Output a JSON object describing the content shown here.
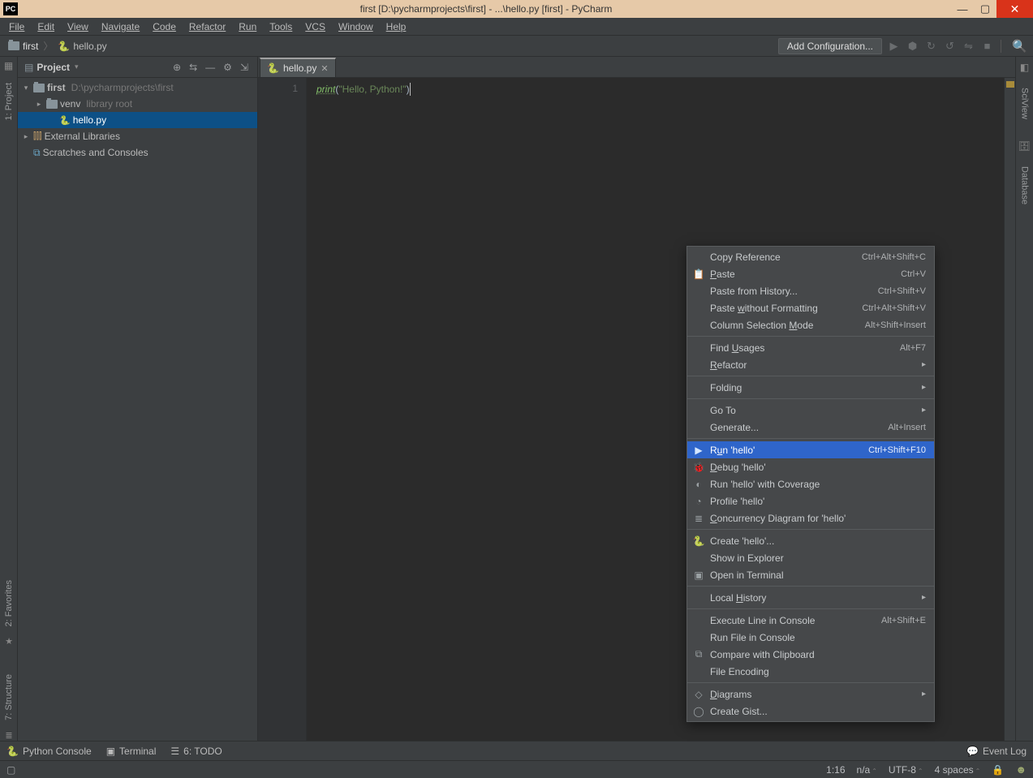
{
  "titlebar": {
    "badge": "PC",
    "title": "first [D:\\pycharmprojects\\first] - ...\\hello.py [first] - PyCharm",
    "min": "—",
    "max": "▢",
    "close": "✕"
  },
  "menubar": [
    "File",
    "Edit",
    "View",
    "Navigate",
    "Code",
    "Refactor",
    "Run",
    "Tools",
    "VCS",
    "Window",
    "Help"
  ],
  "breadcrumb": {
    "folder": "first",
    "file": "hello.py",
    "sep": "〉"
  },
  "navright": {
    "add_conf": "Add Configuration...",
    "icons": [
      "▶",
      "⬢",
      "↻",
      "↺",
      "⇋",
      "■"
    ],
    "search": "🔍"
  },
  "projhdr": {
    "label": "Project",
    "drop": "▾",
    "icons": [
      "⊕",
      "⇆",
      "—",
      "⚙",
      "⇲"
    ]
  },
  "tree": {
    "root": {
      "name": "first",
      "path": "D:\\pycharmprojects\\first"
    },
    "venv": {
      "name": "venv",
      "note": "library root"
    },
    "file": "hello.py",
    "extlib": "External Libraries",
    "scratch": "Scratches and Consoles"
  },
  "leftgutter": {
    "proj": "1: Project"
  },
  "rightgutter": {
    "sci": "SciView",
    "db": "Database"
  },
  "leftbottom": {
    "fav": "2: Favorites",
    "struct": "7: Structure"
  },
  "tab": {
    "name": "hello.py"
  },
  "code": {
    "lineno": "1",
    "print": "print",
    "op": "(",
    "str": "\"Hello, Python!\"",
    "cp": ")"
  },
  "ctx": [
    {
      "t": "item",
      "label": "Copy Reference",
      "key": "Ctrl+Alt+Shift+C"
    },
    {
      "t": "item",
      "icon": "📋",
      "label_html": "<span class='ul'>P</span>aste",
      "key": "Ctrl+V"
    },
    {
      "t": "item",
      "label": "Paste from History...",
      "key": "Ctrl+Shift+V"
    },
    {
      "t": "item",
      "label_html": "Paste <span class='ul'>w</span>ithout Formatting",
      "key": "Ctrl+Alt+Shift+V"
    },
    {
      "t": "item",
      "label_html": "Column Selection <span class='ul'>M</span>ode",
      "key": "Alt+Shift+Insert"
    },
    {
      "t": "sep"
    },
    {
      "t": "item",
      "label_html": "Find <span class='ul'>U</span>sages",
      "key": "Alt+F7"
    },
    {
      "t": "item",
      "label_html": "<span class='ul'>R</span>efactor",
      "sub": "▸"
    },
    {
      "t": "sep"
    },
    {
      "t": "item",
      "label": "Folding",
      "sub": "▸"
    },
    {
      "t": "sep"
    },
    {
      "t": "item",
      "label": "Go To",
      "sub": "▸"
    },
    {
      "t": "item",
      "label": "Generate...",
      "key": "Alt+Insert"
    },
    {
      "t": "sep"
    },
    {
      "t": "item",
      "sel": true,
      "icon": "▶",
      "label_html": "R<span class='ul'>u</span>n 'hello'",
      "key": "Ctrl+Shift+F10"
    },
    {
      "t": "item",
      "icon": "🐞",
      "label_html": "<span class='ul'>D</span>ebug 'hello'"
    },
    {
      "t": "item",
      "icon": "◐",
      "label": "Run 'hello' with Coverage"
    },
    {
      "t": "item",
      "icon": "◔",
      "label": "Profile 'hello'"
    },
    {
      "t": "item",
      "icon": "≣",
      "label_html": "<span class='ul'>C</span>oncurrency Diagram for 'hello'"
    },
    {
      "t": "sep"
    },
    {
      "t": "item",
      "icon": "🐍",
      "label": "Create 'hello'..."
    },
    {
      "t": "item",
      "label": "Show in Explorer"
    },
    {
      "t": "item",
      "icon": "▣",
      "label": "Open in Terminal"
    },
    {
      "t": "sep"
    },
    {
      "t": "item",
      "label_html": "Local <span class='ul'>H</span>istory",
      "sub": "▸"
    },
    {
      "t": "sep"
    },
    {
      "t": "item",
      "label": "Execute Line in Console",
      "key": "Alt+Shift+E"
    },
    {
      "t": "item",
      "label": "Run File in Console"
    },
    {
      "t": "item",
      "icon": "⧉",
      "label": "Compare with Clipboard"
    },
    {
      "t": "item",
      "label": "File Encoding"
    },
    {
      "t": "sep"
    },
    {
      "t": "item",
      "icon": "◇",
      "label_html": "<span class='ul'>D</span>iagrams",
      "sub": "▸"
    },
    {
      "t": "item",
      "icon": "◯",
      "label": "Create Gist..."
    }
  ],
  "toolstrip": {
    "pyconsole": "Python Console",
    "terminal": "Terminal",
    "todo_html": "<span class='ul'>6</span>: TODO",
    "eventlog": "Event Log"
  },
  "status": {
    "sq": "▢",
    "pos": "1:16",
    "na": "n/a",
    "enc": "UTF-8",
    "indent": "4 spaces",
    "lock": "🔒",
    "face": "☻"
  }
}
